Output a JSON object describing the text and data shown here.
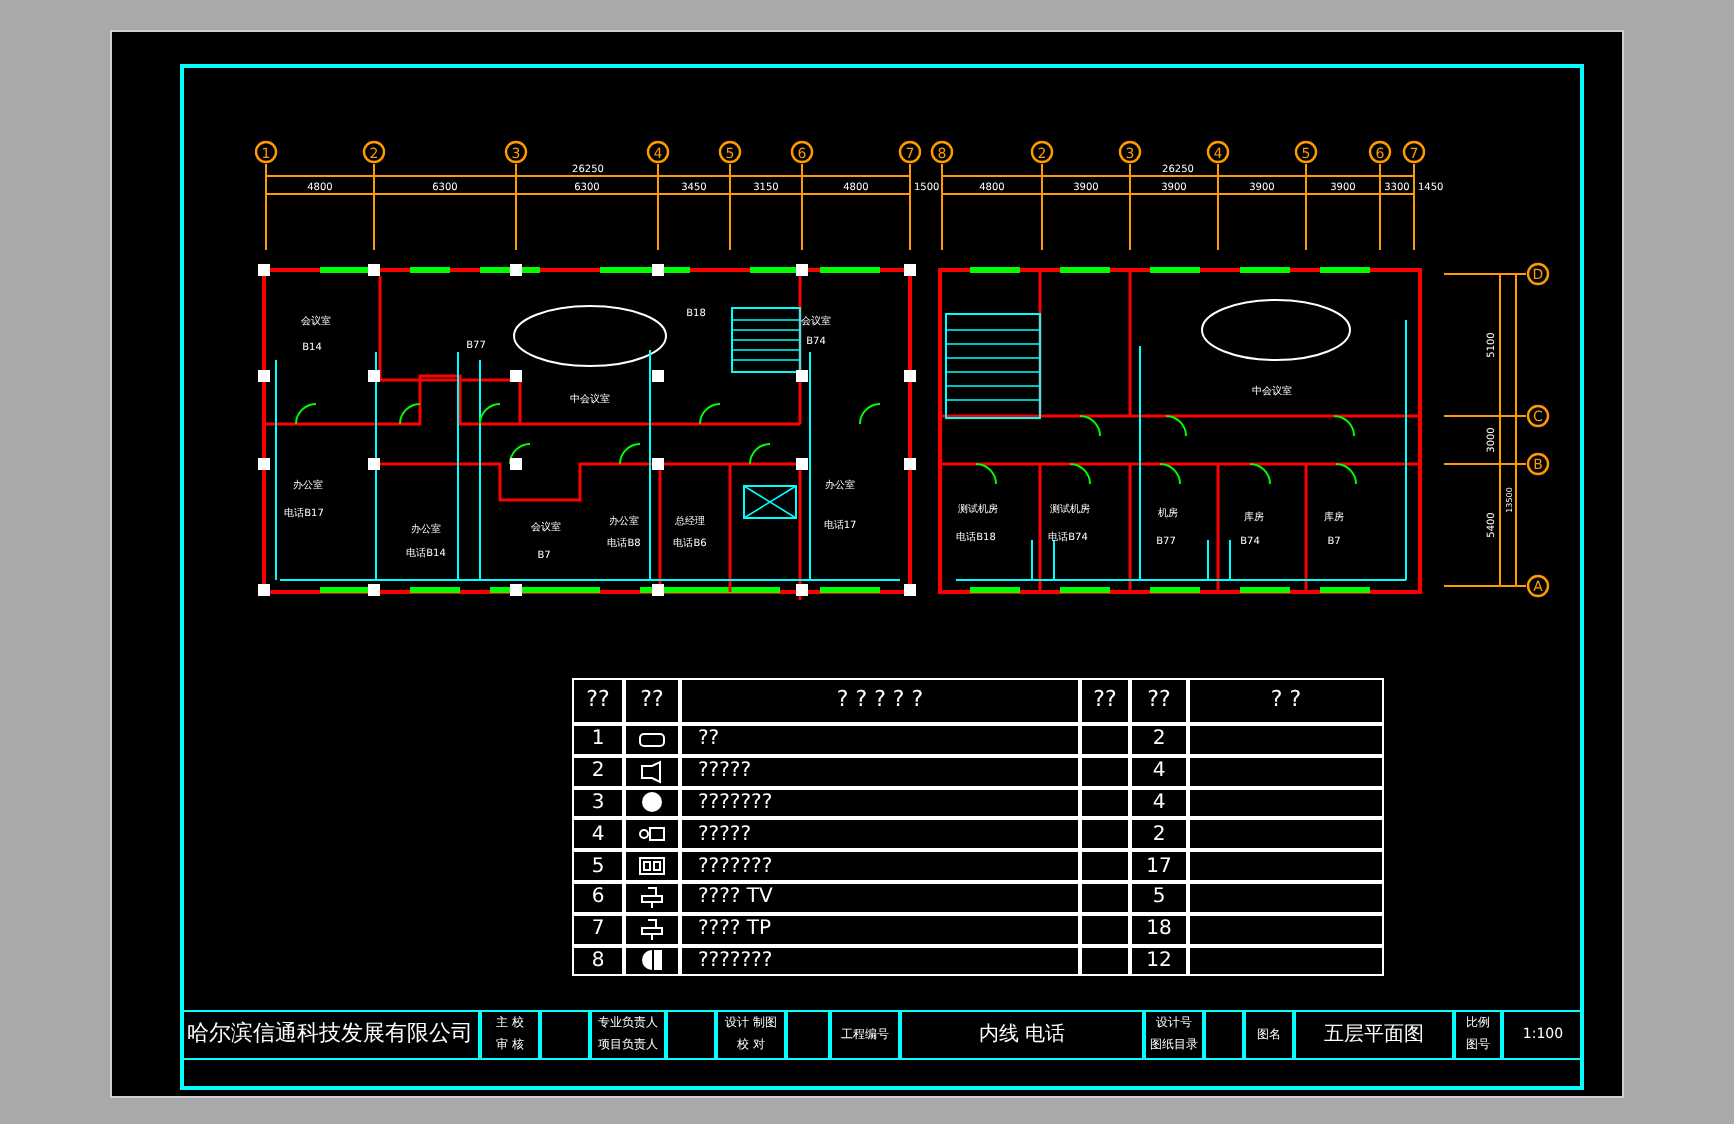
{
  "plan_left": {
    "axes": [
      "1",
      "2",
      "3",
      "4",
      "5",
      "6",
      "7"
    ],
    "total": "26250",
    "dims": [
      "4800",
      "6300",
      "6300",
      "3450",
      "3150",
      "4800",
      "1500"
    ],
    "rooms": [
      "会议室",
      "B14",
      "B77",
      "中会议室",
      "B18",
      "会议室",
      "B74",
      "办公室",
      "电话B17",
      "办公室",
      "电话B14",
      "会议室",
      "B7",
      "办公室",
      "电话B8",
      "总经理",
      "电话B6",
      "办公室",
      "电话17"
    ]
  },
  "plan_right": {
    "axes": [
      "8",
      "2",
      "3",
      "4",
      "5",
      "6",
      "7"
    ],
    "total": "26250",
    "dims": [
      "4800",
      "3900",
      "3900",
      "3900",
      "3900",
      "3300",
      "1450"
    ],
    "rows": [
      "D",
      "C",
      "B",
      "A"
    ],
    "vdims": [
      "5100",
      "3000",
      "5400"
    ],
    "vtotal": "13500",
    "rooms": [
      "中会议室",
      "测试机房",
      "测试机房",
      "电话B18",
      "电话B74",
      "机房",
      "B77",
      "库房",
      "B74",
      "库房",
      "B7"
    ]
  },
  "table": {
    "columns": [
      "??",
      "??",
      "? ? ? ? ?",
      "??",
      "??",
      "? ?"
    ],
    "rows": [
      {
        "no": "1",
        "name": "??",
        "count": "2"
      },
      {
        "no": "2",
        "name": "?????",
        "count": "4"
      },
      {
        "no": "3",
        "name": "???????",
        "count": "4"
      },
      {
        "no": "4",
        "name": "?????",
        "count": "2"
      },
      {
        "no": "5",
        "name": "???????",
        "count": "17"
      },
      {
        "no": "6",
        "name": "???? TV",
        "count": "5"
      },
      {
        "no": "7",
        "name": "???? TP",
        "count": "18"
      },
      {
        "no": "8",
        "name": "???????",
        "count": "12"
      }
    ]
  },
  "title_block": {
    "company": "哈尔滨信通科技发展有限公司",
    "labels_a": [
      "主 校",
      "审 核"
    ],
    "labels_b": [
      "专业负责人",
      "项目负责人"
    ],
    "labels_c": [
      "设计 制图",
      "校 对"
    ],
    "project_no": "工程编号",
    "drawing": "内线 电话",
    "labels_d": [
      "设计号",
      "图纸目录"
    ],
    "label_e": "图名",
    "sheet": "五层平面图",
    "labels_f": [
      "比例",
      "图号"
    ],
    "scale": "1:100"
  }
}
